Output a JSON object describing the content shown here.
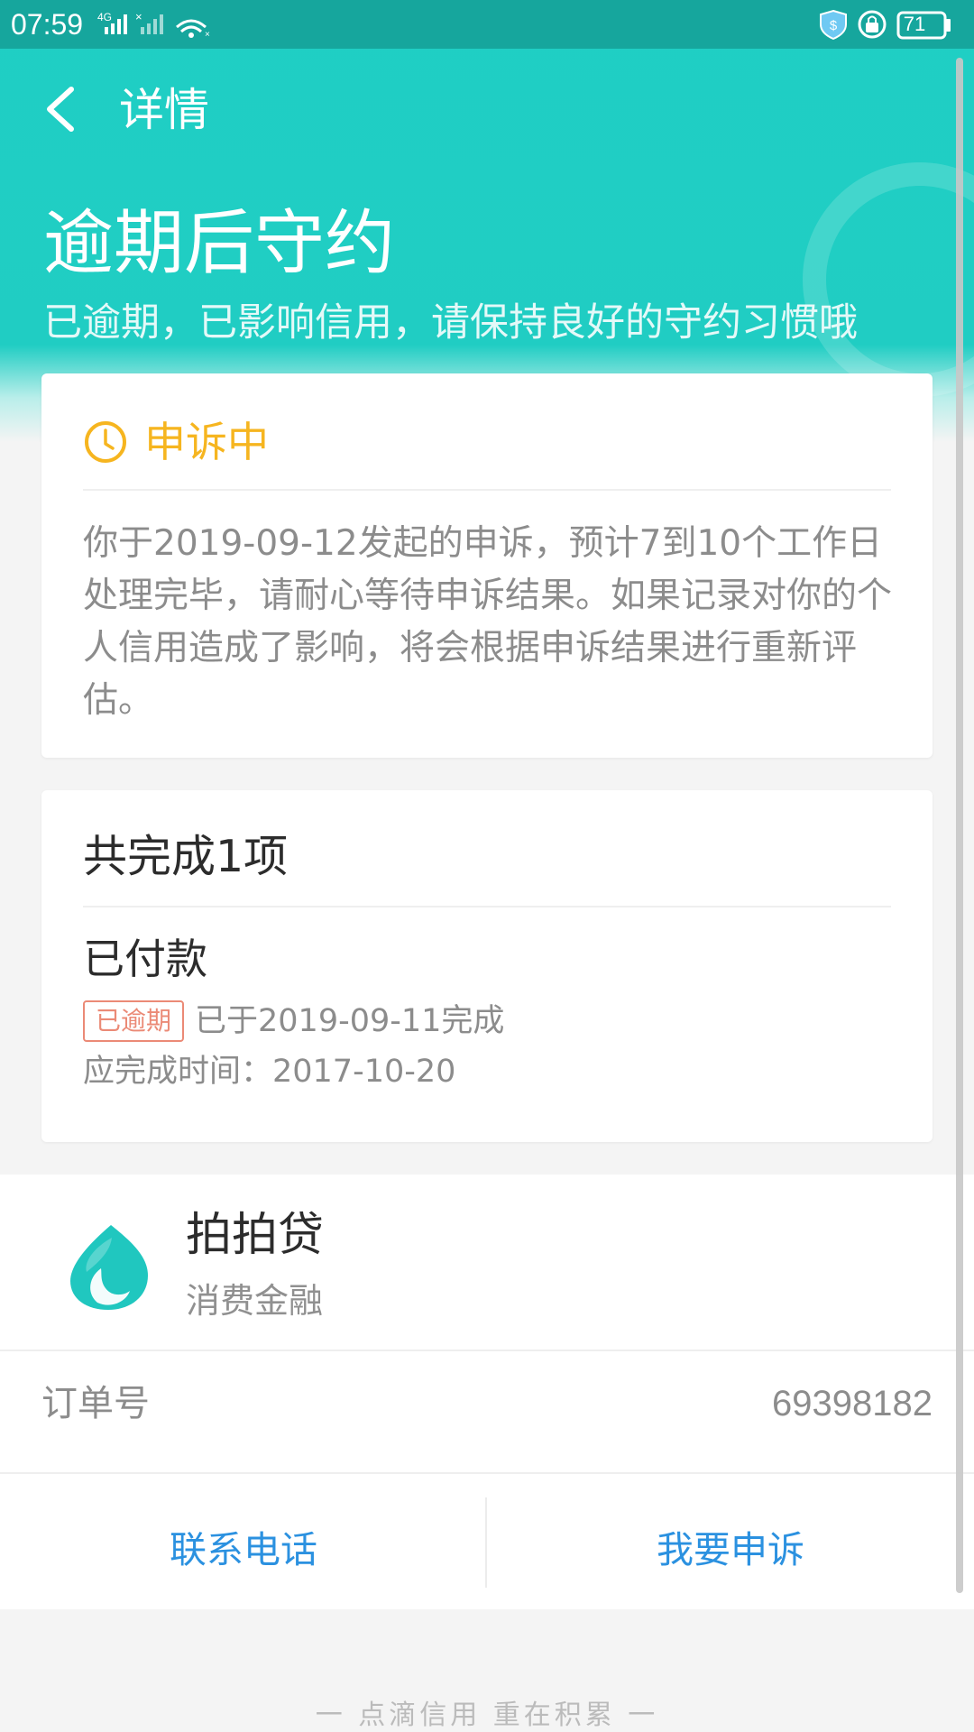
{
  "status_bar": {
    "time": "07:59",
    "network": "4G",
    "battery": "71"
  },
  "header": {
    "title": "详情"
  },
  "hero": {
    "title": "逾期后守约",
    "subtitle": "已逾期，已影响信用，请保持良好的守约习惯哦"
  },
  "status_card": {
    "label": "申诉中",
    "description": "你于2019-09-12发起的申诉，预计7到10个工作日处理完毕，请耐心等待申诉结果。如果记录对你的个人信用造成了影响，将会根据申诉结果进行重新评估。"
  },
  "summary_card": {
    "heading": "共完成1项",
    "item_title": "已付款",
    "badge": "已逾期",
    "completed_text": "已于2019-09-11完成",
    "due_text": "应完成时间：2017-10-20"
  },
  "merchant": {
    "name": "拍拍贷",
    "type": "消费金融",
    "order_label": "订单号",
    "order_value": "69398182"
  },
  "actions": {
    "contact": "联系电话",
    "appeal": "我要申诉"
  },
  "footer": {
    "slogan": "一 点滴信用 重在积累 一"
  },
  "colors": {
    "primary": "#20cdc3",
    "status": "#f6b51f",
    "overdue": "#eb8a76",
    "action": "#2b91e0"
  },
  "icons": {
    "back": "back-arrow-icon",
    "clock": "clock-icon",
    "merchant": "water-drop-icon"
  }
}
